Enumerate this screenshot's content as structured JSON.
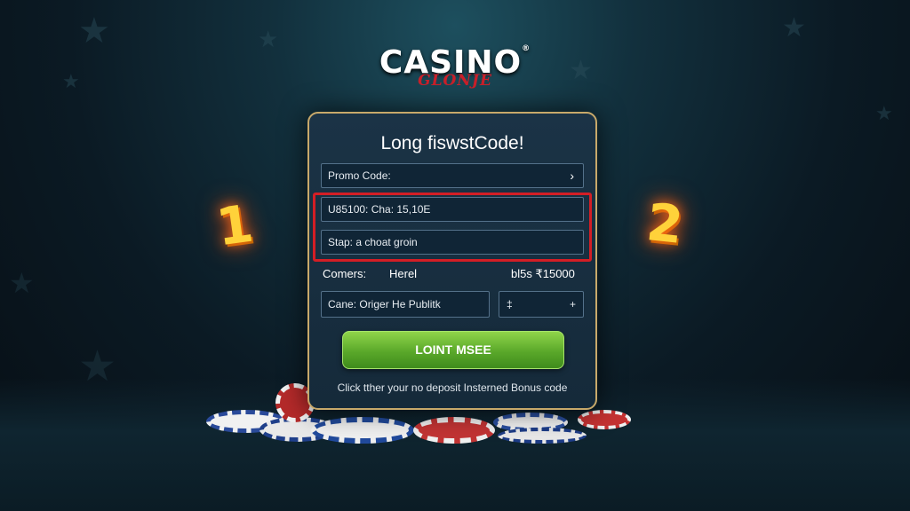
{
  "logo": {
    "main": "CASINO",
    "reg": "®",
    "sub": "GLONJE"
  },
  "steps": [
    "1",
    "2"
  ],
  "card": {
    "title": "Long fiswstCode!",
    "promo_field_label": "Promo Code:",
    "promo_chevron": "›",
    "line1_value": "U85100: Cha: 15,10E",
    "line2_value": "Stap: a choat groin",
    "row_left": "Comers:",
    "row_mid": "Herel",
    "row_right": "bl5s ₹15000",
    "select_value": "Cane: Origer  He Publitk",
    "stepper_value": "‡",
    "stepper_sign": "+",
    "cta_label": "LOINT MSEE",
    "footer": "Click tther your no deposit Insterned Bonus code"
  },
  "colors": {
    "accent_green": "#5aa82a",
    "highlight_red": "#d41e25",
    "card_border_gold": "#c8a96a",
    "step_yellow": "#ffd23a",
    "logo_red": "#c9202a"
  },
  "icons": [
    "star-icon",
    "chevron-right-icon",
    "casino-chips"
  ]
}
